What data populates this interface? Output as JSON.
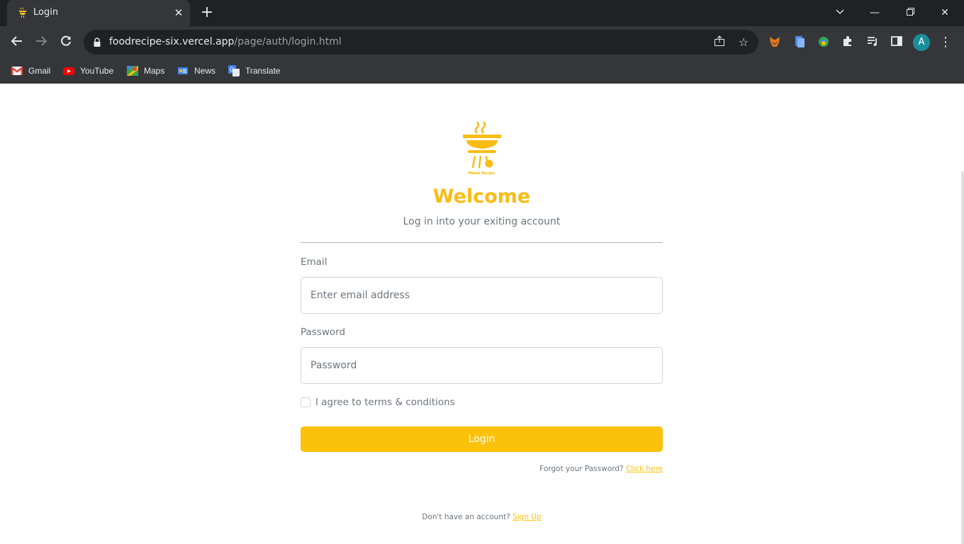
{
  "browser": {
    "tab_title": "Login",
    "url_host": "foodrecipe-six.vercel.app",
    "url_path": "/page/auth/login.html",
    "avatar_letter": "A",
    "bookmarks": [
      {
        "label": "Gmail",
        "icon": "gmail-icon"
      },
      {
        "label": "YouTube",
        "icon": "youtube-icon"
      },
      {
        "label": "Maps",
        "icon": "maps-icon"
      },
      {
        "label": "News",
        "icon": "news-icon"
      },
      {
        "label": "Translate",
        "icon": "translate-icon"
      }
    ]
  },
  "page": {
    "logo_caption": "Mama Recipe.",
    "welcome": "Welcome",
    "subtitle": "Log in into your exiting account",
    "email_label": "Email",
    "email_placeholder": "Enter email address",
    "password_label": "Password",
    "password_placeholder": "Password",
    "agree_label": "I agree to terms & conditions",
    "login_button": "Login",
    "forgot_text": "Forgot your Password?",
    "forgot_link": "Click here",
    "signup_text": "Don't have an account?",
    "signup_link": "Sign Up"
  },
  "colors": {
    "accent": "#fcc10b",
    "chrome_dark": "#202124",
    "chrome_mid": "#35363a"
  }
}
